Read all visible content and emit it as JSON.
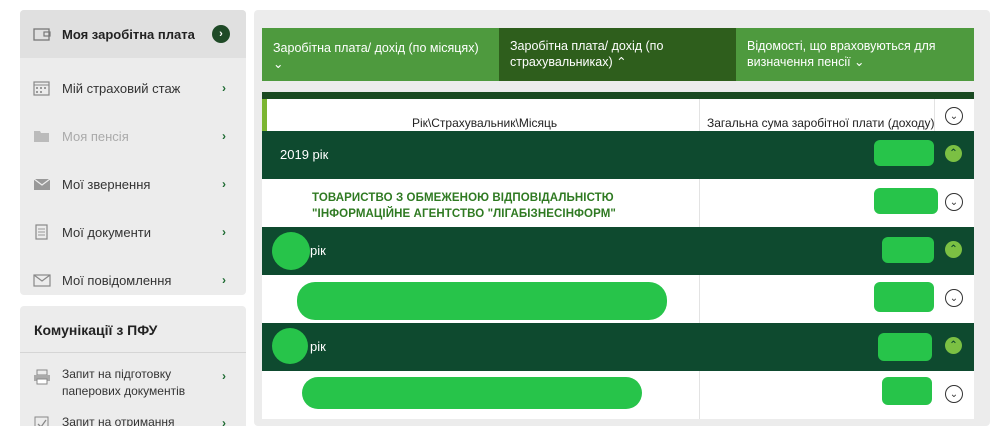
{
  "sidebar": {
    "items": [
      {
        "label": "Моя заробітна плата",
        "icon": "wallet-icon",
        "active": true
      },
      {
        "label": "Мій страховий стаж",
        "icon": "calendar-icon"
      },
      {
        "label": "Моя пенсія",
        "icon": "folder-icon",
        "disabled": true
      },
      {
        "label": "Мої звернення",
        "icon": "envelope-icon"
      },
      {
        "label": "Мої документи",
        "icon": "document-icon"
      },
      {
        "label": "Мої повідомлення",
        "icon": "mail-icon"
      }
    ],
    "arrow": "›",
    "active_arrow": "›"
  },
  "communications": {
    "title": "Комунікації з ПФУ",
    "items": [
      {
        "label": "Запит на підготовку паперових документів",
        "icon": "printer-icon"
      },
      {
        "label": "Запит на отримання",
        "icon": "checklist-icon"
      }
    ]
  },
  "tabs": [
    {
      "label": "Заробітна плата/ дохід (по місяцях) ⌄"
    },
    {
      "label": "Заробітна плата/ дохід (по страхувальниках) ⌃",
      "active": true
    },
    {
      "label": "Відомості, що враховуються для визначення пенсії ⌄"
    }
  ],
  "table": {
    "col1_header": "Рік\\Страхувальник\\Місяць",
    "col2_header": "Загальна сума заробітної плати (доходу)",
    "expand_glyph": "⌄",
    "collapse_glyph": "⌃",
    "rows": [
      {
        "type": "year",
        "label": "2019 рік"
      },
      {
        "type": "employer",
        "label": "ТОВАРИСТВО З ОБМЕЖЕНОЮ ВІДПОВІДАЛЬНІСТЮ \"ІНФОРМАЦІЙНЕ АГЕНТСТВО \"ЛІГАБІЗНЕСІНФОРМ\""
      },
      {
        "type": "year",
        "label": "рік"
      },
      {
        "type": "employer",
        "label": ""
      },
      {
        "type": "year",
        "label": "рік"
      },
      {
        "type": "employer",
        "label": ""
      }
    ]
  },
  "colors": {
    "tab_green": "#4e9a3e",
    "tab_active": "#2e5e1c",
    "year_row": "#0e4a2f",
    "employer_text": "#2f7a22",
    "redaction": "#27c44a"
  }
}
